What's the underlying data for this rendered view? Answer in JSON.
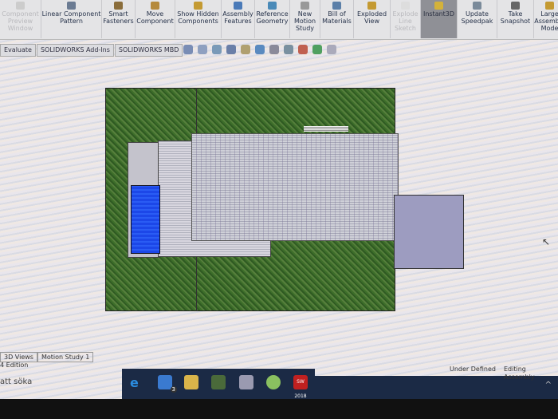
{
  "toolbar": {
    "items": [
      {
        "label": "Component Preview Window",
        "disabled": true
      },
      {
        "label": "Linear Component Pattern"
      },
      {
        "label": "Smart Fasteners"
      },
      {
        "label": "Move Component"
      },
      {
        "label": "Show Hidden Components"
      },
      {
        "label": "Assembly Features"
      },
      {
        "label": "Reference Geometry"
      },
      {
        "label": "New Motion Study"
      },
      {
        "label": "Bill of Materials"
      },
      {
        "label": "Exploded View"
      },
      {
        "label": "Explode Line Sketch",
        "disabled": true
      },
      {
        "label": "Instant3D",
        "active": true
      },
      {
        "label": "Update Speedpak"
      },
      {
        "label": "Take Snapshot"
      },
      {
        "label": "Large Assembly Mode"
      }
    ]
  },
  "tabs": [
    "Evaluate",
    "SOLIDWORKS Add-Ins",
    "SOLIDWORKS MBD"
  ],
  "bottom_tabs": [
    "3D Views",
    "Motion Study 1"
  ],
  "edition": "4 Edition",
  "search_text": "att söka",
  "status": {
    "state": "Under Defined",
    "mode": "Editing Assembly"
  },
  "taskbar": {
    "mail_badge": "3",
    "sw_label": "SW 2018"
  },
  "colors": {
    "grass": "#3d6e2a",
    "pool": "#1c47e8",
    "garage": "#9d9cc0",
    "taskbar": "#1b2a45"
  }
}
